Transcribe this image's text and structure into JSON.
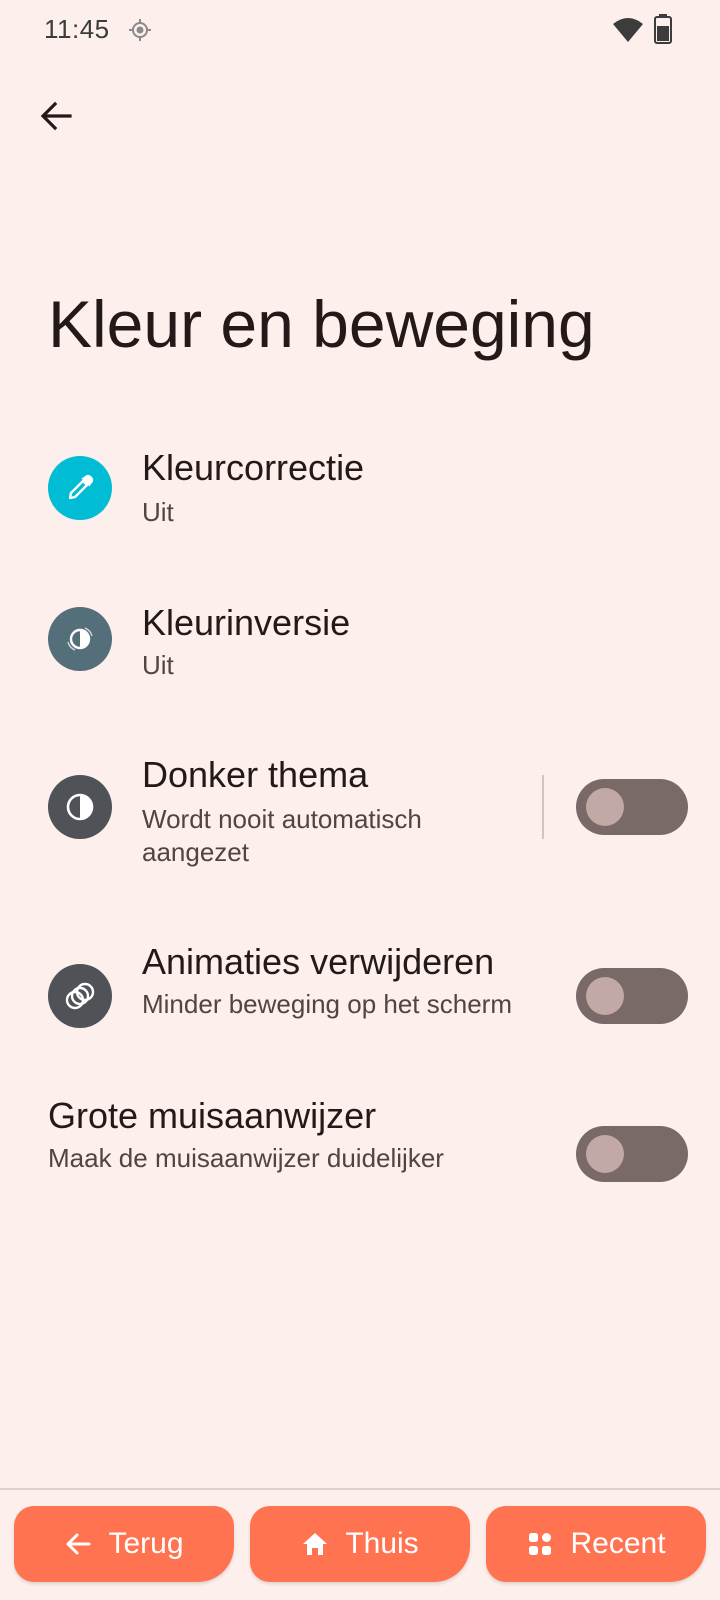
{
  "status_bar": {
    "time": "11:45",
    "icons": [
      "location-icon",
      "wifi-icon",
      "battery-icon"
    ]
  },
  "header": {
    "back_icon": "arrow-back-icon",
    "title": "Kleur en beweging"
  },
  "settings": [
    {
      "title": "Kleurcorrectie",
      "summary": "Uit",
      "icon": "eyedropper-icon",
      "icon_color": "#00bcd4"
    },
    {
      "title": "Kleurinversie",
      "summary": "Uit",
      "icon": "color-inversion-icon",
      "icon_color": "#546e7a"
    },
    {
      "title": "Donker thema",
      "summary": "Wordt nooit automatisch aangezet",
      "icon": "dark-theme-icon",
      "icon_color": "#4f5358",
      "toggle": false
    },
    {
      "title": "Animaties verwijderen",
      "summary": "Minder beweging op het scherm",
      "icon": "remove-animations-icon",
      "icon_color": "#4f5358",
      "toggle": false
    },
    {
      "title": "Grote muisaanwijzer",
      "summary": "Maak de muisaanwijzer duidelijker",
      "toggle": false
    }
  ],
  "nav_bar": {
    "back_label": "Terug",
    "home_label": "Thuis",
    "recent_label": "Recent",
    "accent_color": "#ff7350"
  }
}
